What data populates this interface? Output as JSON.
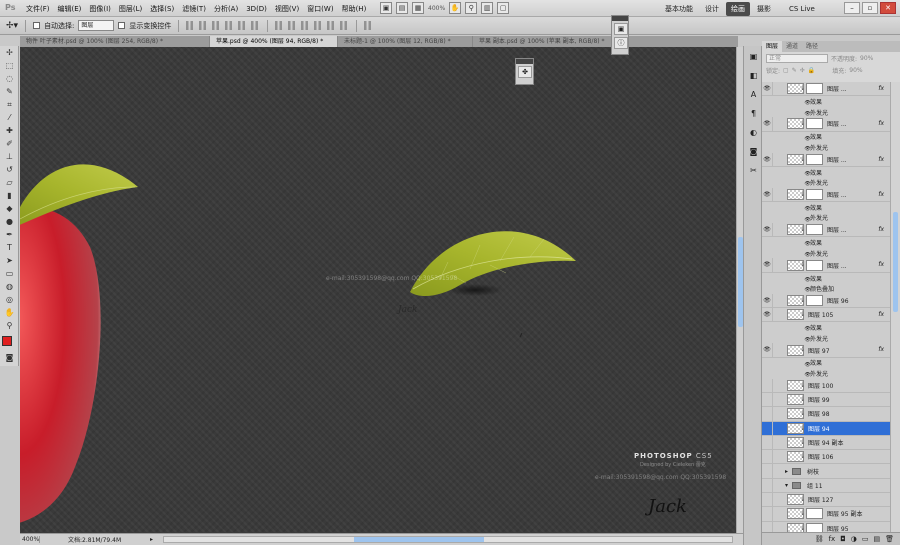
{
  "app": {
    "logo": "Ps"
  },
  "menu": [
    "文件(F)",
    "编辑(E)",
    "图像(I)",
    "图层(L)",
    "选择(S)",
    "滤镜(T)",
    "分析(A)",
    "3D(D)",
    "视图(V)",
    "窗口(W)",
    "帮助(H)"
  ],
  "menubar": {
    "zoom": "400%",
    "workspaces": [
      "基本功能",
      "设计",
      "绘画",
      "摄影"
    ],
    "active_workspace": "绘画",
    "cslive": "CS Live"
  },
  "options": {
    "auto_select_label": "自动选择:",
    "auto_select_value": "图层",
    "transform_label": "显示变换控件"
  },
  "tabs": [
    "物件 叶子素材.psd @ 100% (图层 254, RGB/8) *",
    "苹果.psd @ 400% (图层 94, RGB/8) *",
    "未标题-1 @ 100% (图层 12, RGB/8) *",
    "苹果 副本.psd @ 100% (苹果 副本, RGB/8) *"
  ],
  "canvas": {
    "watermark": "e-mail:305391598@qq.com QQ:305391598",
    "brand_main": "PHOTOSHOP",
    "brand_version": "CS5",
    "brand_sub": "Designed by Cieleken 蕾克",
    "email_bottom": "e-mail:305391598@qq.com QQ:305391598",
    "sig_small": "Jack",
    "sig_large": "Jack"
  },
  "status": {
    "zoom": "400%",
    "doc": "文档:2.81M/79.4M"
  },
  "layers_panel": {
    "tabs": [
      "图层",
      "通道",
      "路径"
    ],
    "blend_mode": "正常",
    "opacity_label": "不透明度:",
    "opacity_value": "90%",
    "lock_label": "锁定:",
    "fill_label": "填充:",
    "fill_value": "90%",
    "rows": [
      {
        "kind": "layer",
        "name": "图层 ...",
        "fx": "fx",
        "mask": true
      },
      {
        "kind": "sub",
        "name": "效果"
      },
      {
        "kind": "sub",
        "name": "外发光"
      },
      {
        "kind": "layer",
        "name": "图层 ...",
        "fx": "fx",
        "mask": true
      },
      {
        "kind": "sub",
        "name": "效果"
      },
      {
        "kind": "sub",
        "name": "外发光"
      },
      {
        "kind": "layer",
        "name": "图层 ...",
        "fx": "fx",
        "mask": true
      },
      {
        "kind": "sub",
        "name": "效果"
      },
      {
        "kind": "sub",
        "name": "外发光"
      },
      {
        "kind": "layer",
        "name": "图层 ...",
        "fx": "fx",
        "mask": true
      },
      {
        "kind": "sub",
        "name": "效果"
      },
      {
        "kind": "sub",
        "name": "外发光"
      },
      {
        "kind": "layer",
        "name": "图层 ...",
        "fx": "fx",
        "mask": true
      },
      {
        "kind": "sub",
        "name": "效果"
      },
      {
        "kind": "sub",
        "name": "外发光"
      },
      {
        "kind": "layer",
        "name": "图层 ...",
        "fx": "fx",
        "mask": true
      },
      {
        "kind": "sub",
        "name": "效果"
      },
      {
        "kind": "sub",
        "name": "颜色叠加"
      },
      {
        "kind": "layer",
        "name": "图层 96",
        "fx": "",
        "mask": true
      },
      {
        "kind": "layer",
        "name": "图层 105",
        "fx": "fx",
        "mask": false
      },
      {
        "kind": "sub",
        "name": "效果"
      },
      {
        "kind": "sub",
        "name": "外发光"
      },
      {
        "kind": "layer",
        "name": "图层 97",
        "fx": "fx",
        "mask": false
      },
      {
        "kind": "sub",
        "name": "效果"
      },
      {
        "kind": "sub",
        "name": "外发光"
      },
      {
        "kind": "layer",
        "name": "图层 100",
        "fx": "",
        "mask": false
      },
      {
        "kind": "layer",
        "name": "图层 99",
        "fx": "",
        "mask": false
      },
      {
        "kind": "layer",
        "name": "图层 98",
        "fx": "",
        "mask": false
      },
      {
        "kind": "layer",
        "name": "图层 94",
        "fx": "",
        "mask": false,
        "selected": true
      },
      {
        "kind": "layer",
        "name": "图层 94 副本",
        "fx": "",
        "mask": false
      },
      {
        "kind": "layer",
        "name": "图层 106",
        "fx": "",
        "mask": false
      },
      {
        "kind": "group",
        "name": "树枝"
      },
      {
        "kind": "group",
        "name": "组 11",
        "open": true
      },
      {
        "kind": "layer",
        "name": "图层 127",
        "fx": "",
        "mask": false
      },
      {
        "kind": "layer",
        "name": "图层 95 副本",
        "fx": "",
        "mask": true
      },
      {
        "kind": "layer",
        "name": "图层 95",
        "fx": "",
        "mask": true
      }
    ]
  },
  "colors": {
    "foreground": "#e01f1f",
    "background": "#ffffff",
    "selection": "#2f6fd6"
  }
}
